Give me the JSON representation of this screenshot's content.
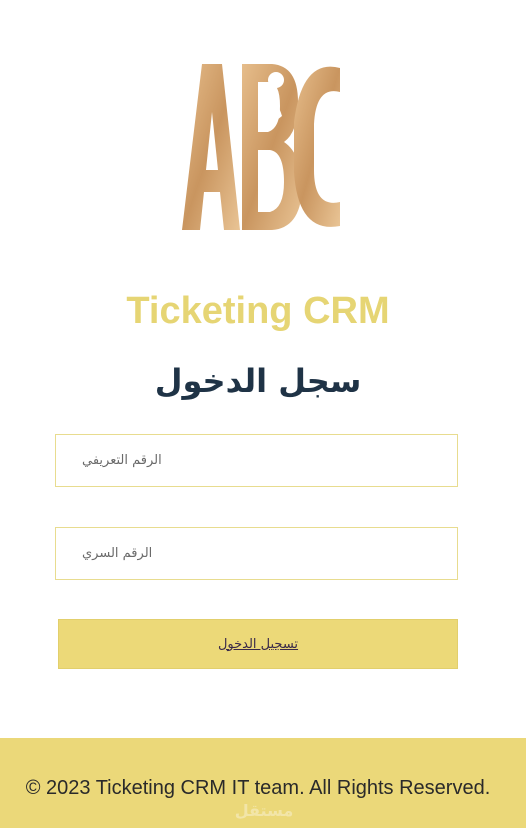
{
  "logo": {
    "letters": "ABC",
    "gradient_start": "#d8a878",
    "gradient_end": "#a8703a"
  },
  "header": {
    "title": "Ticketing CRM",
    "title_color": "#e6d574"
  },
  "login": {
    "heading": "سجل الدخول",
    "id_placeholder": "الرقم التعريفي",
    "password_placeholder": "الرقم السري",
    "submit_label": "تسجيل الدخول"
  },
  "footer": {
    "text": "© 2023 Ticketing CRM IT team. All Rights Reserved.",
    "background": "#ebd879"
  },
  "watermark": {
    "text": "مستقل"
  }
}
